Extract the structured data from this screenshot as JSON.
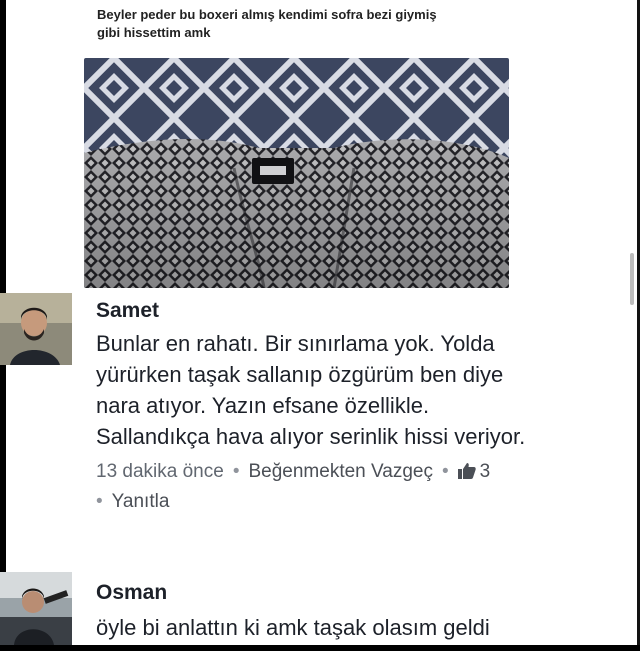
{
  "post": {
    "text_line1": "Beyler peder bu boxeri almış kendimi sofra bezi giymiş",
    "text_line2": "gibi hissettim amk"
  },
  "comments": [
    {
      "name": "Samet",
      "text_lines": [
        "Bunlar en rahatı. Bir sınırlama yok. Yolda",
        "yürürken taşak sallanıp özgürüm ben diye",
        "nara atıyor. Yazın efsane özellikle.",
        "Sallandıkça hava alıyor serinlik hissi veriyor."
      ],
      "time": "13 dakika önce",
      "unlike_label": "Beğenmekten Vazgeç",
      "like_count": "3",
      "reply_label": "Yanıtla",
      "like_icon": "thumbs-up-icon"
    },
    {
      "name": "Osman",
      "text": "öyle bi anlattın ki amk taşak olasım geldi"
    }
  ],
  "colors": {
    "text": "#1d2129",
    "meta": "#616770",
    "link": "#4b4f56",
    "fabric_dark": "#2a2a30",
    "fabric_light": "#d9d9dc"
  }
}
